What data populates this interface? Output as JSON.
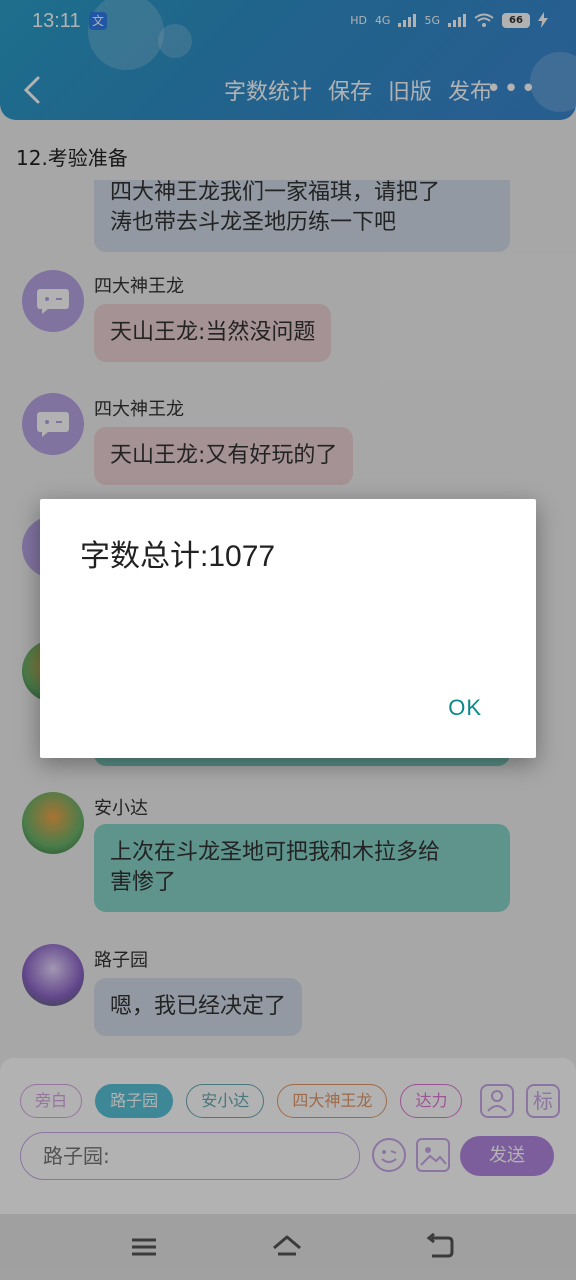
{
  "status": {
    "time": "13:11",
    "app_icon": "文",
    "network_hd": "HD",
    "network_4g": "4G",
    "network_5g": "5G",
    "battery": "66"
  },
  "header": {
    "actions": [
      "字数统计",
      "保存",
      "旧版",
      "发布"
    ],
    "more": "•••"
  },
  "chapter_title": "12.考验准备",
  "messages": [
    {
      "sender": "",
      "text_line1": "四大神王龙我们一家福琪，请把了",
      "text_line2": "涛也带去斗龙圣地历练一下吧",
      "style": "gray"
    },
    {
      "sender": "四大神王龙",
      "text": "天山王龙:当然没问题",
      "style": "pink"
    },
    {
      "sender": "四大神王龙",
      "text": "天山王龙:又有好玩的了",
      "style": "pink"
    },
    {
      "sender": "安小达",
      "text_line1": "上次在斗龙圣地可把我和木拉多给",
      "text_line2": "害惨了",
      "style": "teal"
    },
    {
      "sender": "路子园",
      "text": "嗯，我已经决定了",
      "style": "gray"
    }
  ],
  "input": {
    "chips": [
      "旁白",
      "路子园",
      "安小达",
      "四大神王龙",
      "达力"
    ],
    "active_chip": "路子园",
    "profile_icon": "person-icon",
    "tag_label": "标",
    "text_value": "路子园:",
    "send_label": "发送"
  },
  "dialog": {
    "message": "字数总计:1077",
    "ok_label": "OK"
  },
  "colors": {
    "header": "#2f8fc8",
    "accent_purple": "#b487e1",
    "dialog_button": "#0a8a8a"
  }
}
